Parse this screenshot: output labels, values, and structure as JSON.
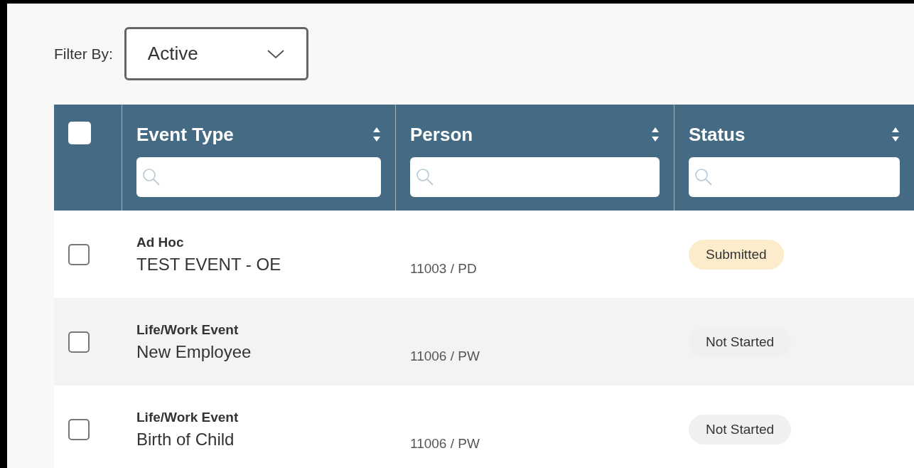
{
  "filter": {
    "label": "Filter By:",
    "value": "Active"
  },
  "table": {
    "select_all": {
      "checked": false
    },
    "columns": [
      {
        "label": "Event Type"
      },
      {
        "label": "Person"
      },
      {
        "label": "Status"
      }
    ],
    "rows": [
      {
        "checked": false,
        "category": "Ad Hoc",
        "event": "TEST EVENT - OE",
        "person": "11003 / PD",
        "status": {
          "label": "Submitted",
          "color": "#fdeccb"
        }
      },
      {
        "checked": false,
        "category": "Life/Work Event",
        "event": "New Employee",
        "person": "11006 / PW",
        "status": {
          "label": "Not Started",
          "color": "#eff0f2"
        }
      },
      {
        "checked": false,
        "category": "Life/Work Event",
        "event": "Birth of Child",
        "person": "11006 / PW",
        "status": {
          "label": "Not Started",
          "color": "#eff0f2"
        }
      }
    ]
  }
}
